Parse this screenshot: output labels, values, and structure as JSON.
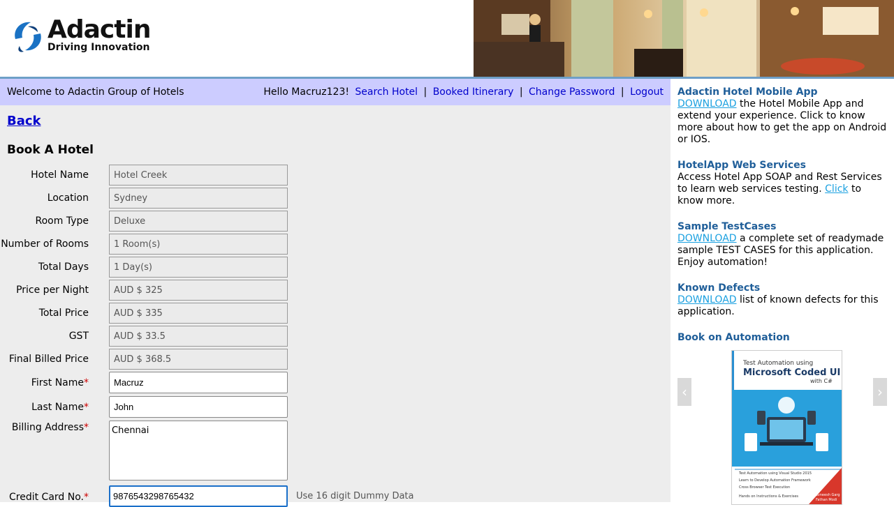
{
  "brand": {
    "title": "Adactin",
    "tagline": "Driving Innovation"
  },
  "nav": {
    "welcome": "Welcome to Adactin Group of Hotels",
    "greeting": "Hello Macruz123!",
    "links": [
      "Search Hotel",
      "Booked Itinerary",
      "Change Password",
      "Logout"
    ],
    "separator": "|"
  },
  "page": {
    "back_label": "Back",
    "title": "Book A Hotel",
    "readonly_fields": [
      {
        "label": "Hotel Name",
        "value": "Hotel Creek"
      },
      {
        "label": "Location",
        "value": "Sydney"
      },
      {
        "label": "Room Type",
        "value": "Deluxe"
      },
      {
        "label": "Number of Rooms",
        "value": "1 Room(s)"
      },
      {
        "label": "Total Days",
        "value": "1 Day(s)"
      },
      {
        "label": "Price per Night",
        "value": "AUD $ 325"
      },
      {
        "label": "Total Price",
        "value": "AUD $ 335"
      },
      {
        "label": "GST",
        "value": "AUD $ 33.5"
      },
      {
        "label": "Final Billed Price",
        "value": "AUD $ 368.5"
      }
    ],
    "first_name": {
      "label": "First Name",
      "value": "Macruz"
    },
    "last_name": {
      "label": "Last Name",
      "value": "John"
    },
    "billing_address": {
      "label": "Billing Address",
      "value": "Chennai"
    },
    "credit_card": {
      "label": "Credit Card No.",
      "value": "9876543298765432",
      "hint": "Use 16 digit Dummy Data"
    },
    "required_mark": "*"
  },
  "sidebar": {
    "mobile": {
      "title": "Adactin Hotel Mobile App",
      "link": "DOWNLOAD",
      "text": " the Hotel Mobile App and extend your experience. Click to know more about how to get the app on Android or IOS."
    },
    "webservices": {
      "title": "HotelApp Web Services",
      "text_before": "Access Hotel App SOAP and Rest Services to learn web services testing. ",
      "link": "Click",
      "text_after": " to know more."
    },
    "testcases": {
      "title": "Sample TestCases",
      "link": "DOWNLOAD",
      "text": " a complete set of readymade sample TEST CASES for this application. Enjoy automation!"
    },
    "defects": {
      "title": "Known Defects",
      "link": "DOWNLOAD",
      "text": " list of known defects for this application."
    },
    "book": {
      "title": "Book on Automation",
      "cover_line1": "Test Automation using",
      "cover_line2": "Microsoft Coded UI",
      "cover_line3": "with C#",
      "bullets": [
        "Test Automation using Visual Studio 2015",
        "Learn to Develop Automation Framework",
        "Cross Browser Test Execution",
        "Hands on Instructions & Exercises"
      ],
      "authors": [
        "Navneesh Garg",
        "Fathan Modi"
      ]
    },
    "carousel_prev": "‹",
    "carousel_next": "›"
  },
  "colors": {
    "nav_bg": "#ccccff",
    "link": "#0000cc",
    "sidebar_heading": "#1f5e99",
    "sidebar_link": "#1aa0e0",
    "required": "#cc0000"
  }
}
